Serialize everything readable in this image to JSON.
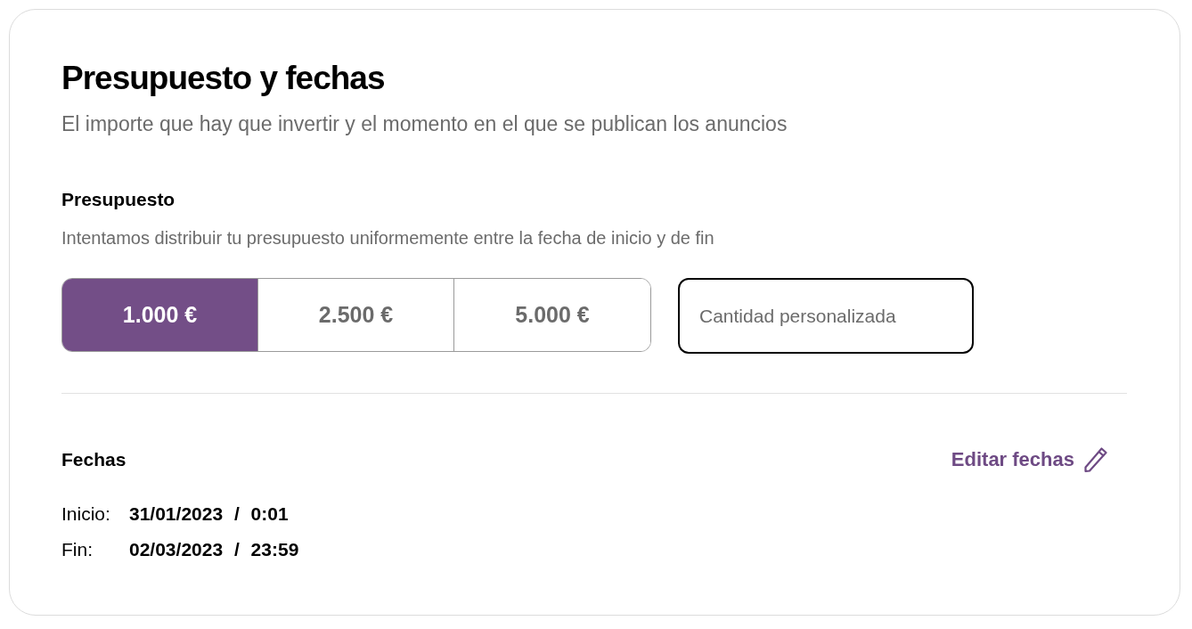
{
  "section": {
    "title": "Presupuesto y fechas",
    "subtitle": "El importe que hay que invertir y el momento en el que se publican los anuncios"
  },
  "budget": {
    "title": "Presupuesto",
    "description": "Intentamos distribuir tu presupuesto uniformemente entre la fecha de inicio y de fin",
    "options": [
      {
        "label": "1.000 €",
        "selected": true
      },
      {
        "label": "2.500 €",
        "selected": false
      },
      {
        "label": "5.000 €",
        "selected": false
      }
    ],
    "custom_amount": {
      "placeholder": "Cantidad personalizada"
    }
  },
  "dates": {
    "title": "Fechas",
    "edit_link": "Editar fechas",
    "rows": [
      {
        "label": "Inicio:",
        "value": "31/01/2023 / 0:01"
      },
      {
        "label": "Fin:",
        "value": "02/03/2023 / 23:59"
      }
    ]
  }
}
